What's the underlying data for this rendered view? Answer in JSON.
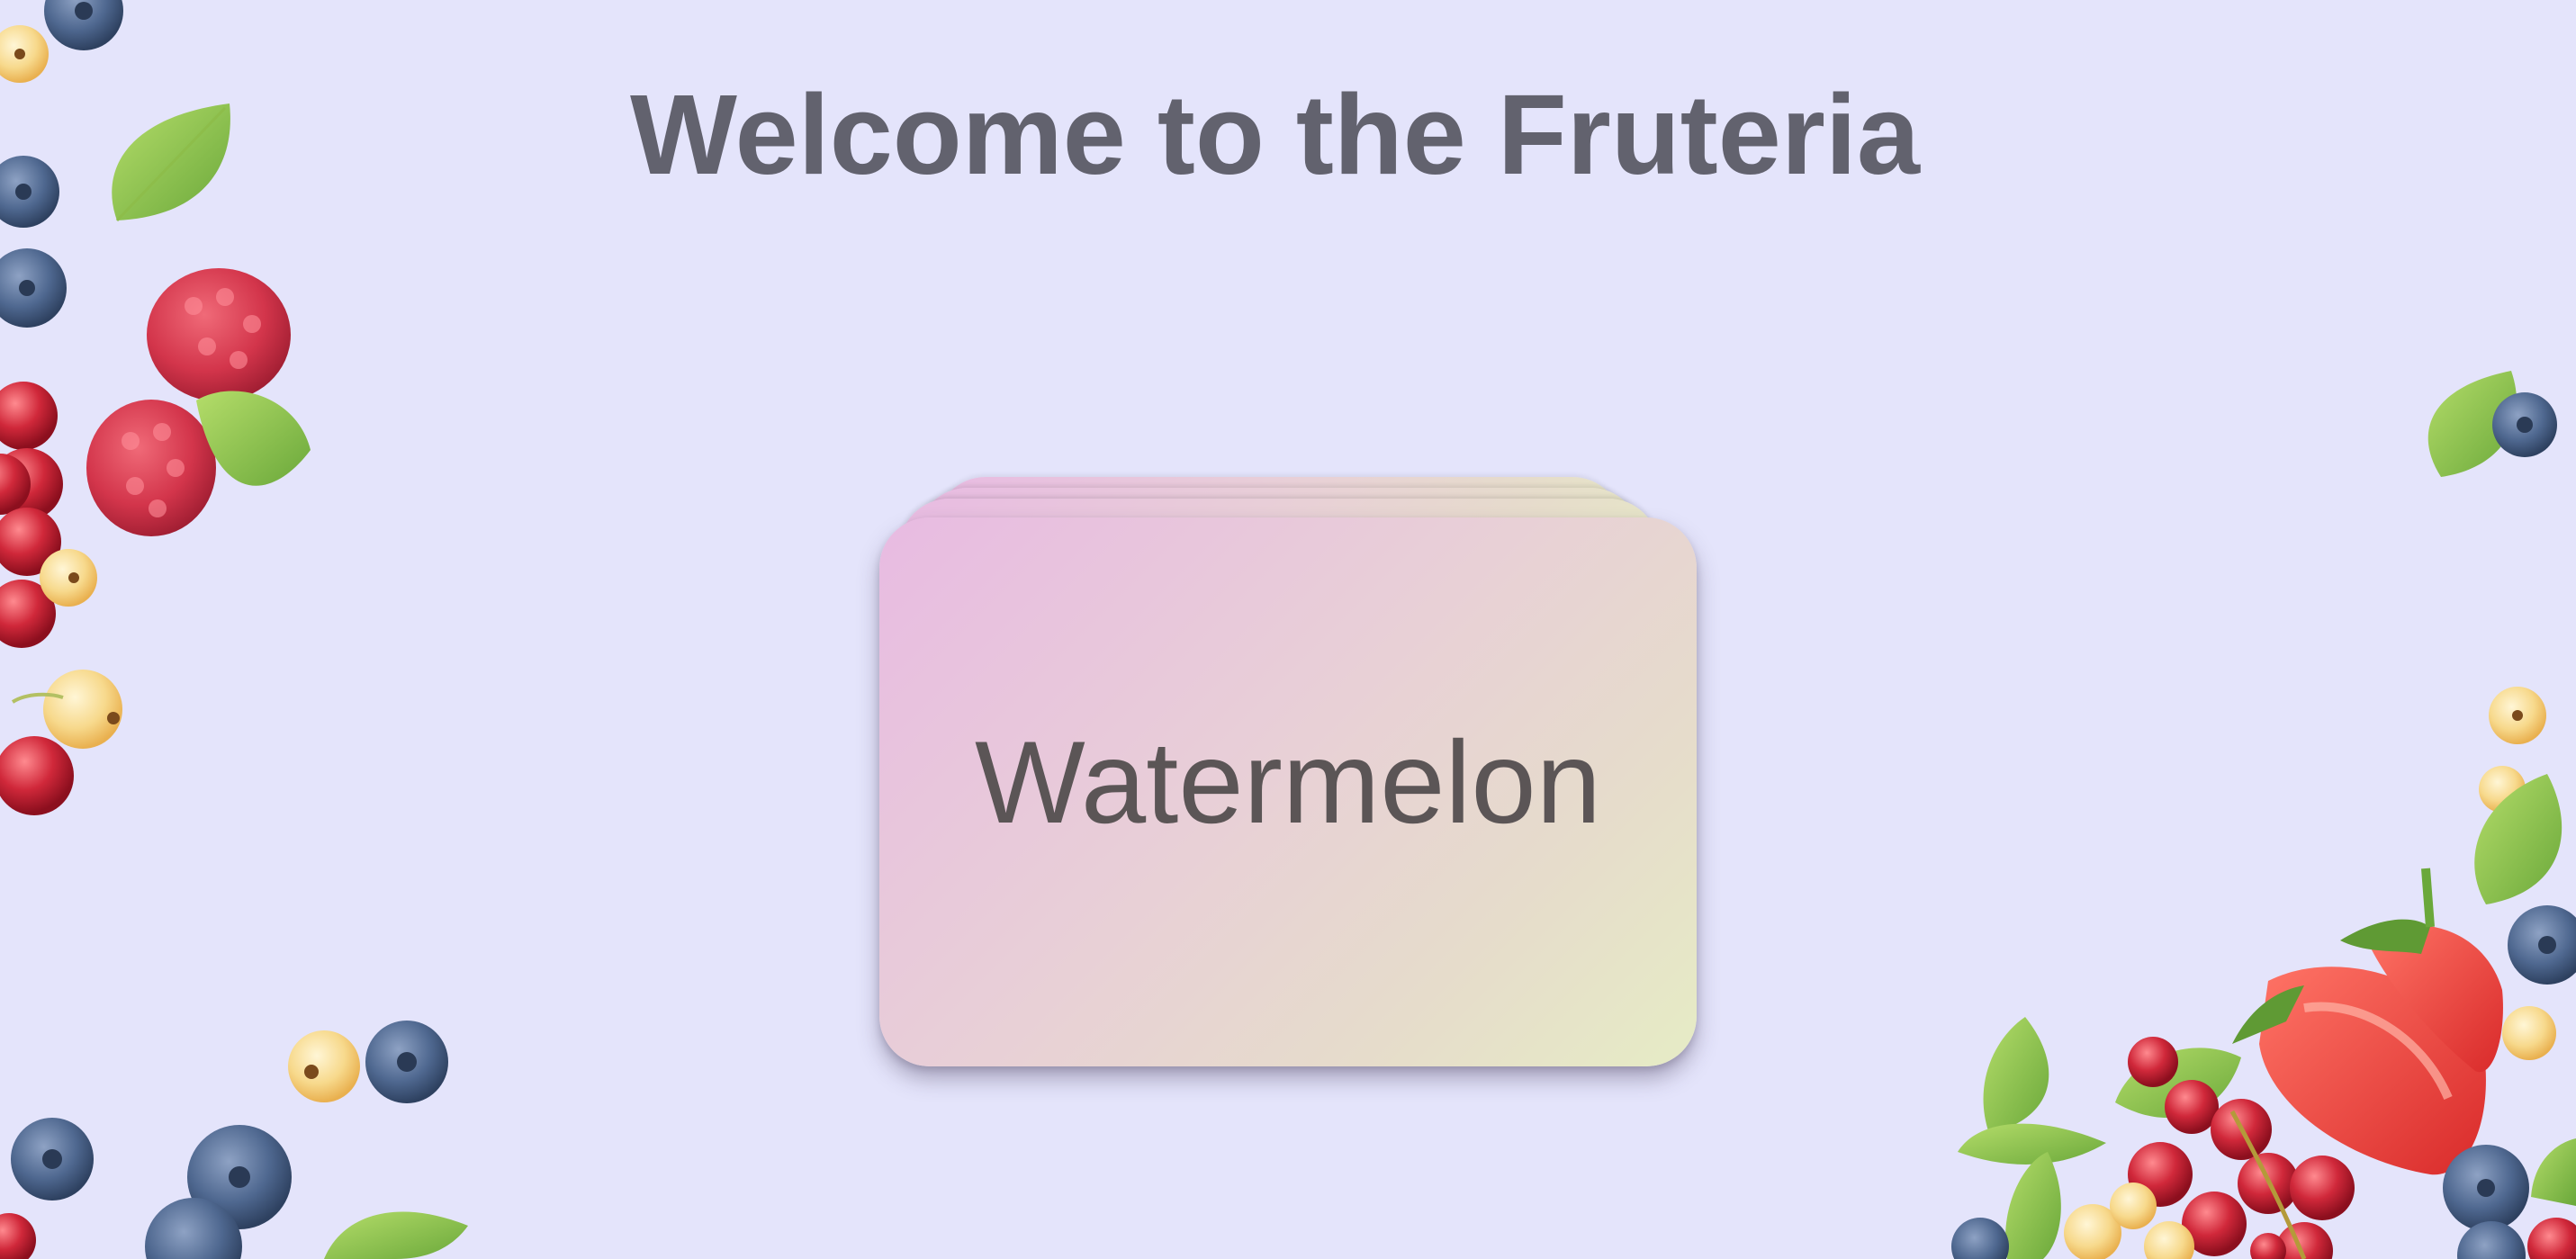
{
  "header": {
    "title": "Welcome to the Fruteria"
  },
  "card_stack": {
    "current_card_label": "Watermelon",
    "gradient_colors": [
      "#e8bbe2",
      "#e6ecc5"
    ]
  },
  "decorations": {
    "icons": [
      "blueberry-icon",
      "raspberry-icon",
      "redcurrant-icon",
      "whitecurrant-icon",
      "mint-leaf-icon",
      "strawberry-icon"
    ]
  },
  "colors": {
    "background": "#e4e4fb",
    "title_text": "#62626e",
    "card_text": "#5b5556"
  }
}
